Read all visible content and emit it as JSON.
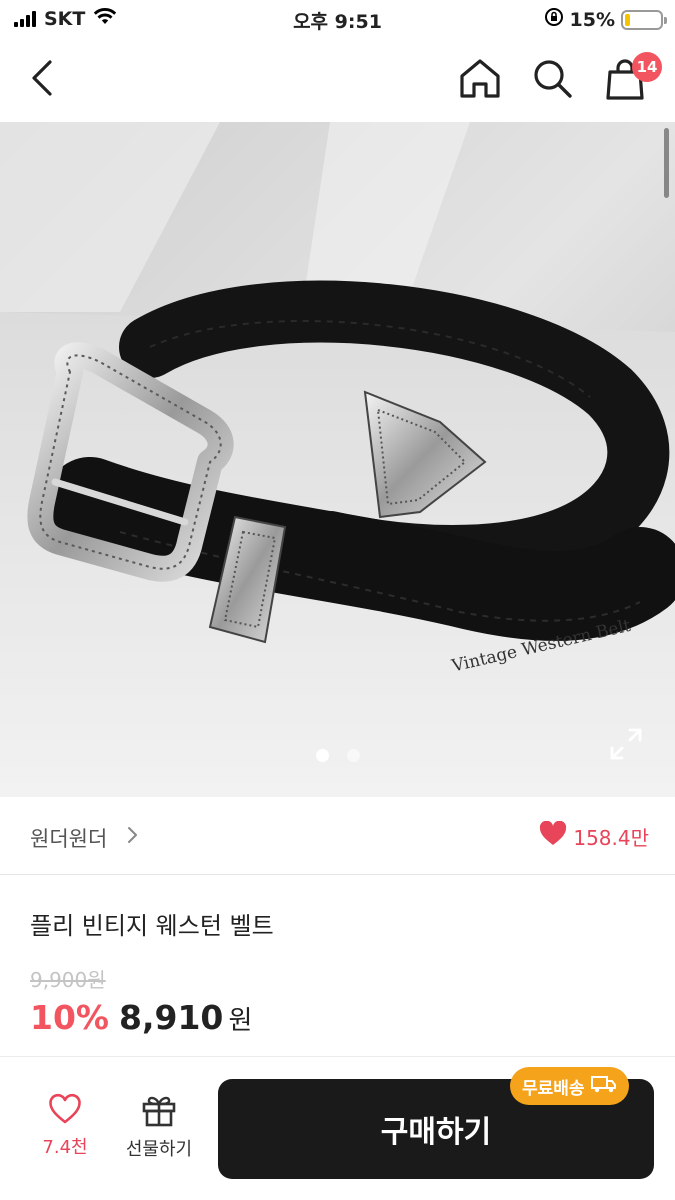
{
  "status_bar": {
    "carrier": "SKT",
    "time": "오후 9:51",
    "battery_percent": "15%",
    "battery_level": 0.15
  },
  "nav": {
    "cart_count": "14",
    "icons": [
      "back-arrow-icon",
      "home-icon",
      "search-icon",
      "shopping-bag-icon"
    ]
  },
  "product_image": {
    "watermark_text": "Vintage Western Belt",
    "slide_count": 2,
    "active_slide": 1
  },
  "brand": {
    "name": "원더원더",
    "likes": "158.4만"
  },
  "product": {
    "title": "플리 빈티지 웨스턴 벨트",
    "original_price": "9,900원",
    "discount": "10%",
    "sale_price": "8,910",
    "currency": "원"
  },
  "bottom_bar": {
    "wish_count": "7.4천",
    "gift_label": "선물하기",
    "buy_label": "구매하기",
    "shipping_badge": "무료배송"
  },
  "colors": {
    "accent_red": "#f2555f",
    "like_pink": "#e8445a",
    "buy_button": "#1a1a1a",
    "shipping_badge": "#f6a31c"
  }
}
